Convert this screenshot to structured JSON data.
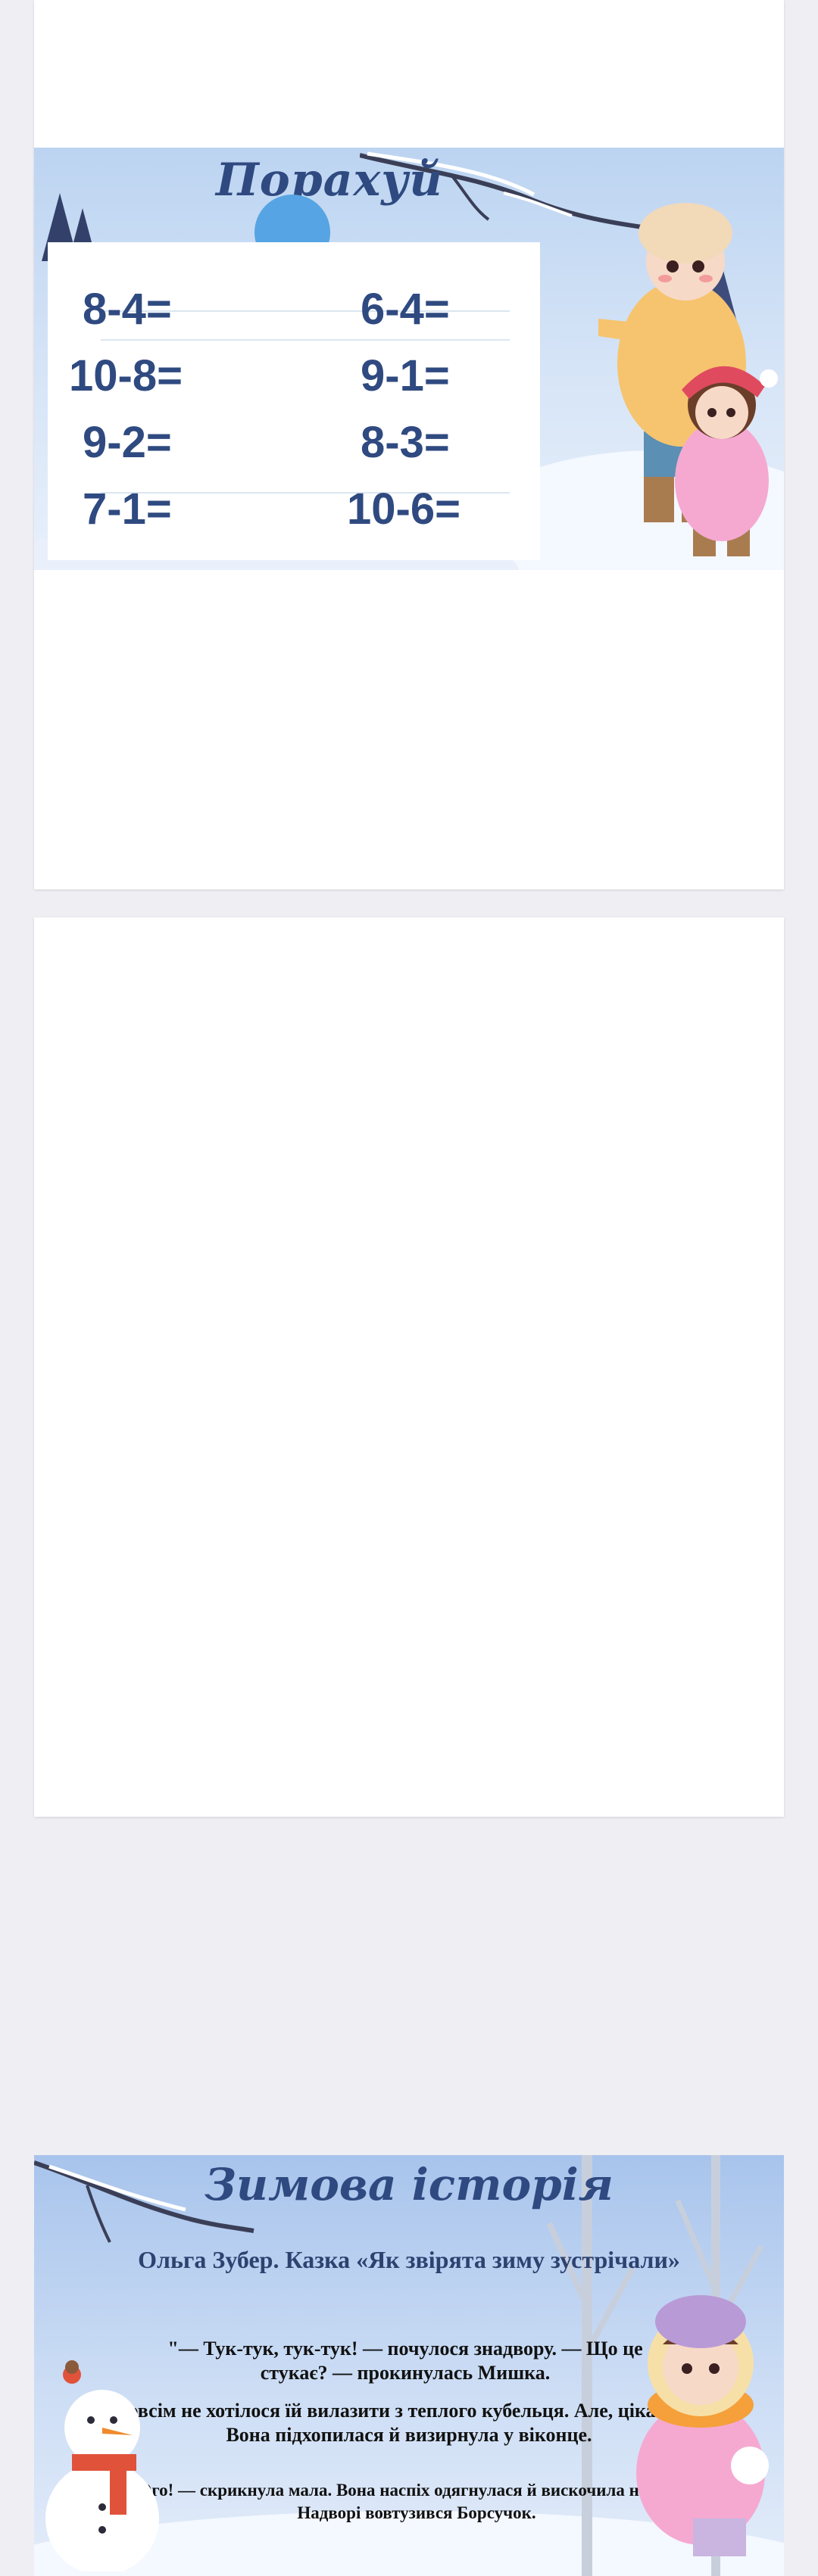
{
  "slide1": {
    "title": "Порахуй",
    "problems": {
      "left": [
        "8-4=",
        "10-8=",
        "9-2=",
        "7-1="
      ],
      "right": [
        "6-4=",
        "9-1=",
        "8-3=",
        "10-6="
      ]
    }
  },
  "slide2": {
    "title": "Зимова історія",
    "subtitle": "Ольга Зубер. Казка «Як звірята зиму зустрічали»",
    "story": [
      "\"— Тук-тук, тук-тук! — почулося знадвору. — Що це стукає? — прокинулась Мишка.",
      "Зовсім не хотілося їй вилазити з теплого кубельця. Але, цікаво ж. Вона підхопилася й визирнула у віконце.",
      "— Ого! — скрикнула мала. Вона наспіх одягнулася й вискочила на вулицю. Надворі вовтузився Борсучок."
    ]
  },
  "colors": {
    "background": "#eeeef3",
    "page": "#ffffff",
    "title_blue": "#2f4a80",
    "circle_blue": "#56a4e3"
  }
}
